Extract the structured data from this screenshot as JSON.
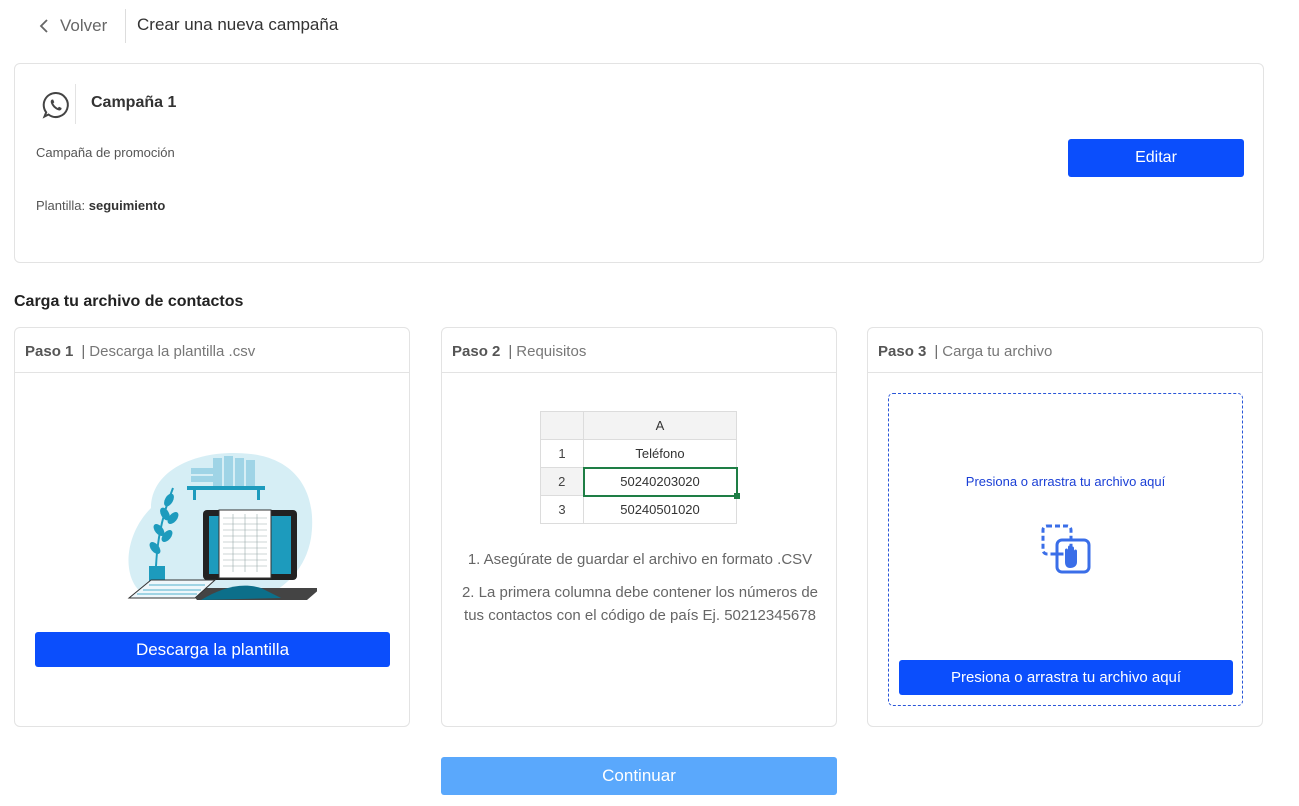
{
  "header": {
    "back_label": "Volver",
    "title": "Crear una nueva campaña"
  },
  "campaign": {
    "icon": "whatsapp-icon",
    "name": "Campaña 1",
    "description": "Campaña de promoción",
    "template_label": "Plantilla:",
    "template_value": "seguimiento",
    "edit_label": "Editar"
  },
  "upload_section": {
    "title": "Carga tu archivo de contactos",
    "step1": {
      "number": "Paso 1",
      "sep": "|",
      "title": "Descarga la plantilla .csv",
      "button": "Descarga la plantilla"
    },
    "step2": {
      "number": "Paso 2",
      "sep": "|",
      "title": "Requisitos",
      "sheet": {
        "column": "A",
        "rows": [
          {
            "n": "1",
            "v": "Teléfono"
          },
          {
            "n": "2",
            "v": "50240203020"
          },
          {
            "n": "3",
            "v": "50240501020"
          }
        ]
      },
      "req1": "1. Asegúrate de guardar el archivo en formato .CSV",
      "req2": "2. La primera columna debe contener los números de tus contactos con el código de país Ej. 50212345678"
    },
    "step3": {
      "number": "Paso 3",
      "sep": "|",
      "title": "Carga tu archivo",
      "drop_text": "Presiona o arrastra tu archivo aquí",
      "button": "Presiona o arrastra tu archivo aquí"
    }
  },
  "continue_label": "Continuar",
  "colors": {
    "primary": "#0b4efc",
    "continue_disabled": "#5aa8fc",
    "sheet_active_border": "#1e7e45",
    "dropzone_border": "#2a56d8"
  }
}
